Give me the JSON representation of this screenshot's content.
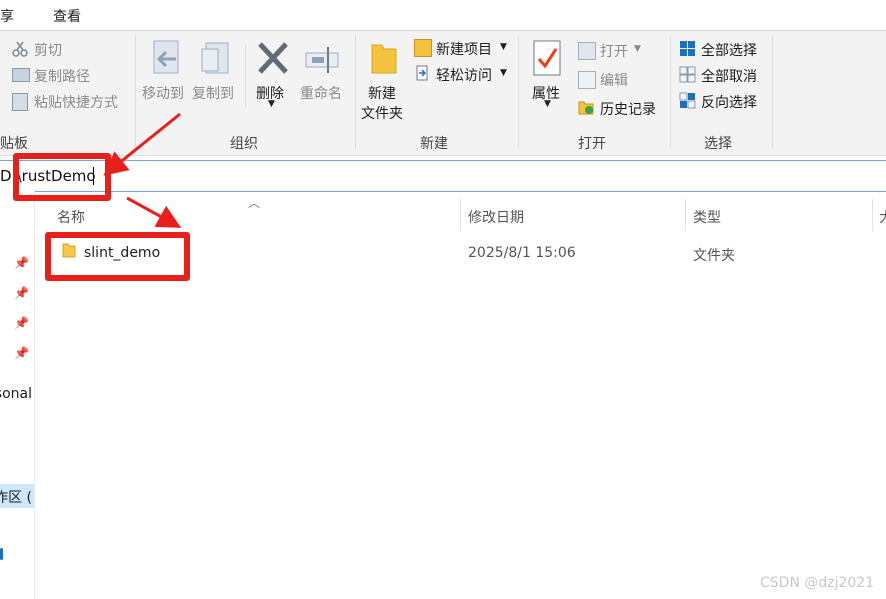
{
  "tabs": {
    "share": "共享",
    "view": "查看"
  },
  "ribbon": {
    "clipboard": {
      "cut": "剪切",
      "copy_path": "复制路径",
      "paste_shortcut": "粘贴快捷方式",
      "group_label": "剪贴板"
    },
    "organize": {
      "move_to": "移动到",
      "copy_to": "复制到",
      "delete": "删除",
      "rename": "重命名",
      "group_label": "组织"
    },
    "new": {
      "new_folder_line1": "新建",
      "new_folder_line2": "文件夹",
      "new_item": "新建项目",
      "easy_access": "轻松访问",
      "group_label": "新建"
    },
    "open": {
      "properties": "属性",
      "open": "打开",
      "edit": "编辑",
      "history": "历史记录",
      "group_label": "打开"
    },
    "select": {
      "select_all": "全部选择",
      "select_none": "全部取消",
      "invert": "反向选择",
      "group_label": "选择"
    }
  },
  "address": {
    "path": "D:\\rustDemo"
  },
  "nav": {
    "item_personal": "Personal",
    "item_desktop_area": "工作区 ("
  },
  "columns": {
    "name": "名称",
    "date": "修改日期",
    "type": "类型",
    "size": "大"
  },
  "files": [
    {
      "name": "slint_demo",
      "date": "2025/8/1 15:06",
      "type": "文件夹"
    }
  ],
  "watermark": "CSDN @dzj2021",
  "colors": {
    "annotation_red": "#e8201c",
    "folder_yellow": "#f6c94a",
    "accent_blue": "#1f6fbf"
  }
}
